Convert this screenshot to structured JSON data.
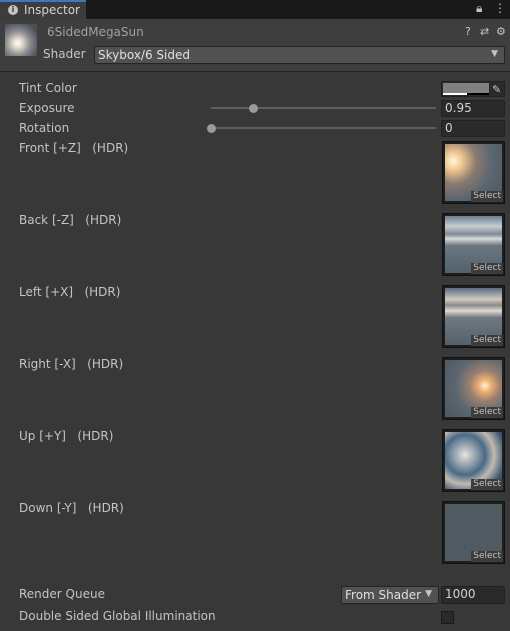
{
  "tab": {
    "label": "Inspector"
  },
  "header": {
    "title": "6SidedMegaSun",
    "shader_label": "Shader",
    "shader_value": "Skybox/6 Sided"
  },
  "properties": {
    "tint_label": "Tint Color",
    "exposure_label": "Exposure",
    "exposure_value": "0.95",
    "exposure_level": 0.19,
    "rotation_label": "Rotation",
    "rotation_value": "0",
    "rotation_level": 0.0
  },
  "textures": [
    {
      "label": "Front [+Z]   (HDR)",
      "select": "Select"
    },
    {
      "label": "Back [-Z]   (HDR)",
      "select": "Select"
    },
    {
      "label": "Left [+X]   (HDR)",
      "select": "Select"
    },
    {
      "label": "Right [-X]   (HDR)",
      "select": "Select"
    },
    {
      "label": "Up [+Y]   (HDR)",
      "select": "Select"
    },
    {
      "label": "Down [-Y]   (HDR)",
      "select": "Select"
    }
  ],
  "render_queue": {
    "label": "Render Queue",
    "mode": "From Shader",
    "value": "1000"
  },
  "double_sided": {
    "label": "Double Sided Global Illumination",
    "checked": false
  },
  "colors": {
    "accent": "#3a79bb",
    "background": "#383838",
    "field": "#2a2a2a"
  },
  "icons": [
    "info-icon",
    "lock-icon",
    "menu-icon",
    "help-icon",
    "sliders-icon",
    "gear-icon",
    "eyedropper-icon",
    "dropdown-arrow-icon"
  ]
}
